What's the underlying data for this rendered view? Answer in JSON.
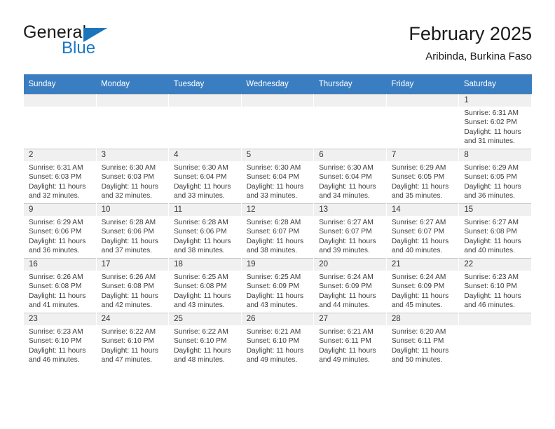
{
  "brand": {
    "name_part1": "General",
    "name_part2": "Blue",
    "triangle_color": "#1b75bb"
  },
  "header": {
    "month_title": "February 2025",
    "location": "Aribinda, Burkina Faso"
  },
  "theme": {
    "header_row_color": "#3a7ec1",
    "daynum_bar_color": "#f0f0f0",
    "grid_line_color": "#c9c9c9",
    "text_color": "#3c3c3c"
  },
  "weekdays": [
    "Sunday",
    "Monday",
    "Tuesday",
    "Wednesday",
    "Thursday",
    "Friday",
    "Saturday"
  ],
  "weeks": [
    [
      {
        "day": "",
        "empty": true
      },
      {
        "day": "",
        "empty": true
      },
      {
        "day": "",
        "empty": true
      },
      {
        "day": "",
        "empty": true
      },
      {
        "day": "",
        "empty": true
      },
      {
        "day": "",
        "empty": true
      },
      {
        "day": "1",
        "sunrise": "Sunrise: 6:31 AM",
        "sunset": "Sunset: 6:02 PM",
        "daylight1": "Daylight: 11 hours",
        "daylight2": "and 31 minutes."
      }
    ],
    [
      {
        "day": "2",
        "sunrise": "Sunrise: 6:31 AM",
        "sunset": "Sunset: 6:03 PM",
        "daylight1": "Daylight: 11 hours",
        "daylight2": "and 32 minutes."
      },
      {
        "day": "3",
        "sunrise": "Sunrise: 6:30 AM",
        "sunset": "Sunset: 6:03 PM",
        "daylight1": "Daylight: 11 hours",
        "daylight2": "and 32 minutes."
      },
      {
        "day": "4",
        "sunrise": "Sunrise: 6:30 AM",
        "sunset": "Sunset: 6:04 PM",
        "daylight1": "Daylight: 11 hours",
        "daylight2": "and 33 minutes."
      },
      {
        "day": "5",
        "sunrise": "Sunrise: 6:30 AM",
        "sunset": "Sunset: 6:04 PM",
        "daylight1": "Daylight: 11 hours",
        "daylight2": "and 33 minutes."
      },
      {
        "day": "6",
        "sunrise": "Sunrise: 6:30 AM",
        "sunset": "Sunset: 6:04 PM",
        "daylight1": "Daylight: 11 hours",
        "daylight2": "and 34 minutes."
      },
      {
        "day": "7",
        "sunrise": "Sunrise: 6:29 AM",
        "sunset": "Sunset: 6:05 PM",
        "daylight1": "Daylight: 11 hours",
        "daylight2": "and 35 minutes."
      },
      {
        "day": "8",
        "sunrise": "Sunrise: 6:29 AM",
        "sunset": "Sunset: 6:05 PM",
        "daylight1": "Daylight: 11 hours",
        "daylight2": "and 36 minutes."
      }
    ],
    [
      {
        "day": "9",
        "sunrise": "Sunrise: 6:29 AM",
        "sunset": "Sunset: 6:06 PM",
        "daylight1": "Daylight: 11 hours",
        "daylight2": "and 36 minutes."
      },
      {
        "day": "10",
        "sunrise": "Sunrise: 6:28 AM",
        "sunset": "Sunset: 6:06 PM",
        "daylight1": "Daylight: 11 hours",
        "daylight2": "and 37 minutes."
      },
      {
        "day": "11",
        "sunrise": "Sunrise: 6:28 AM",
        "sunset": "Sunset: 6:06 PM",
        "daylight1": "Daylight: 11 hours",
        "daylight2": "and 38 minutes."
      },
      {
        "day": "12",
        "sunrise": "Sunrise: 6:28 AM",
        "sunset": "Sunset: 6:07 PM",
        "daylight1": "Daylight: 11 hours",
        "daylight2": "and 38 minutes."
      },
      {
        "day": "13",
        "sunrise": "Sunrise: 6:27 AM",
        "sunset": "Sunset: 6:07 PM",
        "daylight1": "Daylight: 11 hours",
        "daylight2": "and 39 minutes."
      },
      {
        "day": "14",
        "sunrise": "Sunrise: 6:27 AM",
        "sunset": "Sunset: 6:07 PM",
        "daylight1": "Daylight: 11 hours",
        "daylight2": "and 40 minutes."
      },
      {
        "day": "15",
        "sunrise": "Sunrise: 6:27 AM",
        "sunset": "Sunset: 6:08 PM",
        "daylight1": "Daylight: 11 hours",
        "daylight2": "and 40 minutes."
      }
    ],
    [
      {
        "day": "16",
        "sunrise": "Sunrise: 6:26 AM",
        "sunset": "Sunset: 6:08 PM",
        "daylight1": "Daylight: 11 hours",
        "daylight2": "and 41 minutes."
      },
      {
        "day": "17",
        "sunrise": "Sunrise: 6:26 AM",
        "sunset": "Sunset: 6:08 PM",
        "daylight1": "Daylight: 11 hours",
        "daylight2": "and 42 minutes."
      },
      {
        "day": "18",
        "sunrise": "Sunrise: 6:25 AM",
        "sunset": "Sunset: 6:08 PM",
        "daylight1": "Daylight: 11 hours",
        "daylight2": "and 43 minutes."
      },
      {
        "day": "19",
        "sunrise": "Sunrise: 6:25 AM",
        "sunset": "Sunset: 6:09 PM",
        "daylight1": "Daylight: 11 hours",
        "daylight2": "and 43 minutes."
      },
      {
        "day": "20",
        "sunrise": "Sunrise: 6:24 AM",
        "sunset": "Sunset: 6:09 PM",
        "daylight1": "Daylight: 11 hours",
        "daylight2": "and 44 minutes."
      },
      {
        "day": "21",
        "sunrise": "Sunrise: 6:24 AM",
        "sunset": "Sunset: 6:09 PM",
        "daylight1": "Daylight: 11 hours",
        "daylight2": "and 45 minutes."
      },
      {
        "day": "22",
        "sunrise": "Sunrise: 6:23 AM",
        "sunset": "Sunset: 6:10 PM",
        "daylight1": "Daylight: 11 hours",
        "daylight2": "and 46 minutes."
      }
    ],
    [
      {
        "day": "23",
        "sunrise": "Sunrise: 6:23 AM",
        "sunset": "Sunset: 6:10 PM",
        "daylight1": "Daylight: 11 hours",
        "daylight2": "and 46 minutes."
      },
      {
        "day": "24",
        "sunrise": "Sunrise: 6:22 AM",
        "sunset": "Sunset: 6:10 PM",
        "daylight1": "Daylight: 11 hours",
        "daylight2": "and 47 minutes."
      },
      {
        "day": "25",
        "sunrise": "Sunrise: 6:22 AM",
        "sunset": "Sunset: 6:10 PM",
        "daylight1": "Daylight: 11 hours",
        "daylight2": "and 48 minutes."
      },
      {
        "day": "26",
        "sunrise": "Sunrise: 6:21 AM",
        "sunset": "Sunset: 6:10 PM",
        "daylight1": "Daylight: 11 hours",
        "daylight2": "and 49 minutes."
      },
      {
        "day": "27",
        "sunrise": "Sunrise: 6:21 AM",
        "sunset": "Sunset: 6:11 PM",
        "daylight1": "Daylight: 11 hours",
        "daylight2": "and 49 minutes."
      },
      {
        "day": "28",
        "sunrise": "Sunrise: 6:20 AM",
        "sunset": "Sunset: 6:11 PM",
        "daylight1": "Daylight: 11 hours",
        "daylight2": "and 50 minutes."
      },
      {
        "day": "",
        "empty": true
      }
    ]
  ]
}
